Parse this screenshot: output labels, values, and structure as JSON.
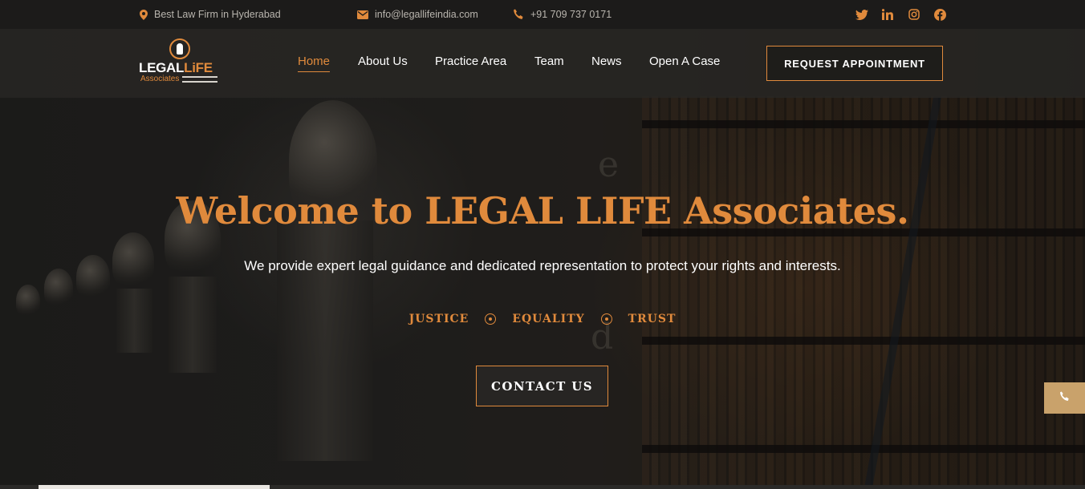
{
  "topbar": {
    "location": "Best Law Firm in Hyderabad",
    "email": "info@legallifeindia.com",
    "phone": "+91 709 737 0171",
    "location_icon": "map-pin-icon",
    "email_icon": "envelope-icon",
    "phone_icon": "phone-icon",
    "social": [
      {
        "name": "twitter-icon",
        "glyph": "🐦"
      },
      {
        "name": "linkedin-icon",
        "glyph": "in"
      },
      {
        "name": "instagram-icon",
        "glyph": "◎"
      },
      {
        "name": "facebook-icon",
        "glyph": "f"
      }
    ]
  },
  "logo": {
    "name_part1": "LEGAL",
    "name_part2": "LiFE",
    "sub": "Associates"
  },
  "nav": {
    "items": [
      "Home",
      "About Us",
      "Practice Area",
      "Team",
      "News",
      "Open A Case"
    ],
    "active": "Home",
    "cta": "REQUEST APPOINTMENT"
  },
  "hero": {
    "title": "Welcome to LEGAL LIFE Associates.",
    "subtitle": "We provide expert legal guidance and dedicated representation to protect your rights and interests.",
    "values": [
      "JUSTICE",
      "EQUALITY",
      "TRUST"
    ],
    "cta": "CONTACT US"
  },
  "floating": {
    "call_icon": "phone-icon"
  },
  "colors": {
    "accent": "#e08a3c",
    "background": "#1b1a18",
    "header": "#282725",
    "floating_button": "#c9a26b"
  }
}
